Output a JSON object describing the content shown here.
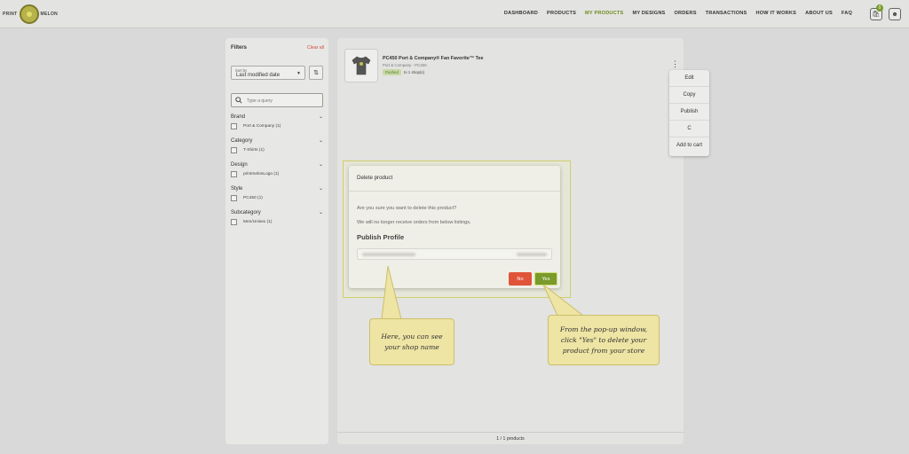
{
  "header": {
    "logo_left": "PRINT",
    "logo_right": "MELON",
    "nav": [
      {
        "label": "DASHBOARD",
        "active": false
      },
      {
        "label": "PRODUCTS",
        "active": false
      },
      {
        "label": "MY PRODUCTS",
        "active": true
      },
      {
        "label": "MY DESIGNS",
        "active": false
      },
      {
        "label": "ORDERS",
        "active": false
      },
      {
        "label": "TRANSACTIONS",
        "active": false
      },
      {
        "label": "HOW IT WORKS",
        "active": false
      },
      {
        "label": "ABOUT US",
        "active": false
      },
      {
        "label": "FAQ",
        "active": false
      }
    ],
    "cart_count": "0",
    "icons": {
      "cart": "bag-icon",
      "account": "user-icon"
    }
  },
  "filters": {
    "title": "Filters",
    "clear_all": "Clear all",
    "sort_label": "Sort by",
    "sort_value": "Last modified date",
    "search_placeholder": "Type a query",
    "groups": [
      {
        "name": "Brand",
        "option": "Port & Company (1)"
      },
      {
        "name": "Category",
        "option": "T-Shirts (1)"
      },
      {
        "name": "Design",
        "option": "printmelonLogo (1)"
      },
      {
        "name": "Style",
        "option": "PC450 (1)"
      },
      {
        "name": "Subcategory",
        "option": "Men/Unisex (1)"
      }
    ]
  },
  "product": {
    "name": "PC450 Port & Company® Fan Favorite™ Tee",
    "sub": "Port & Company - PC450",
    "status": "Pushed",
    "status_meta": "to 1 shop(s)"
  },
  "action_menu": [
    "Edit",
    "Copy",
    "Publish",
    "C",
    "Add to cart"
  ],
  "products_footer": "1 / 1 products",
  "dialog": {
    "title": "Delete product",
    "question": "Are you sure you want to delete this product?",
    "note": "We will no longer receive orders from below listings.",
    "section": "Publish Profile",
    "no_label": "No",
    "yes_label": "Yes"
  },
  "callouts": {
    "shop_name": [
      "Here, you can see",
      "your shop name"
    ],
    "delete_hint": [
      "From the pop-up window,",
      "click \"Yes\" to delete your",
      "product from your store"
    ]
  },
  "colors": {
    "accent": "#7a9a2a",
    "danger": "#e0543a",
    "callout": "#eee4a4"
  }
}
